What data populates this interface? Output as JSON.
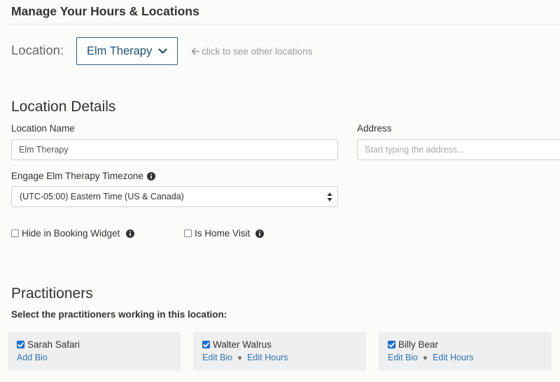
{
  "header": {
    "title": "Manage Your Hours & Locations"
  },
  "location_picker": {
    "label": "Location:",
    "selected": "Elm Therapy",
    "hint": "click to see other locations"
  },
  "details": {
    "heading": "Location Details",
    "name_label": "Location Name",
    "name_value": "Elm Therapy",
    "address_label": "Address",
    "address_placeholder": "Start typing the address...",
    "timezone_label": "Engage Elm Therapy Timezone",
    "timezone_value": "(UTC-05:00) Eastern Time (US & Canada)",
    "hide_label": "Hide in Booking Widget",
    "hide_checked": false,
    "home_visit_label": "Is Home Visit",
    "home_visit_checked": false
  },
  "practitioners": {
    "heading": "Practitioners",
    "subtext": "Select the practitioners working in this location:",
    "items": [
      {
        "name": "Sarah Safari",
        "checked": true,
        "links": [
          "Add Bio"
        ]
      },
      {
        "name": "Walter Walrus",
        "checked": true,
        "links": [
          "Edit Bio",
          "Edit Hours"
        ]
      },
      {
        "name": "Billy Bear",
        "checked": true,
        "links": [
          "Edit Bio",
          "Edit Hours"
        ]
      }
    ]
  },
  "colors": {
    "accent": "#1f4f74",
    "link": "#2e74b5",
    "checkbox": "#1a73e8",
    "card_bg": "#efefef",
    "page_bg": "#fbfbfa"
  },
  "icons": {
    "location_chevron": "chevron-down-icon",
    "hint_arrow": "arrow-left-icon",
    "info": "info-icon",
    "select_arrows": "select-updown-icon",
    "check": "checkmark-icon"
  }
}
